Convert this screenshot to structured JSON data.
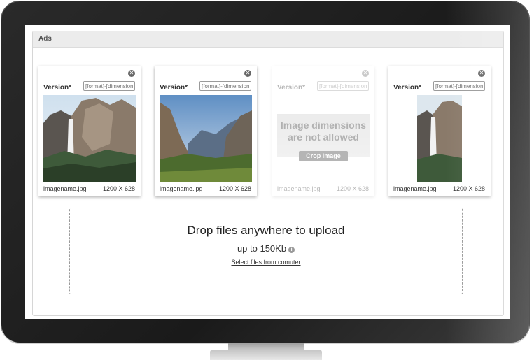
{
  "panel": {
    "title": "Ads"
  },
  "cards": [
    {
      "version_label": "Version*",
      "version_placeholder": "[format]-[dimensions]",
      "filename": "imagename.jpg",
      "size": "1200 X 628"
    },
    {
      "version_label": "Version*",
      "version_placeholder": "[format]-[dimensions]",
      "filename": "imagename.jpg",
      "size": "1200 X 628"
    },
    {
      "version_label": "Version*",
      "version_placeholder": "[format]-[dimensions]",
      "filename": "imagename.jpg",
      "size": "1200 X 628",
      "notice": "Image dimensions are not allowed",
      "crop_label": "Crop image"
    },
    {
      "version_label": "Version*",
      "version_placeholder": "[format]-[dimensions]",
      "filename": "imagename.jpg",
      "size": "1200 X 628"
    }
  ],
  "dropzone": {
    "title": "Drop files anywhere to upload",
    "limit": "up to 150Kb",
    "select_link": "Select files from comuter"
  },
  "icons": {
    "close": "close-circle-icon",
    "info": "info-icon"
  }
}
